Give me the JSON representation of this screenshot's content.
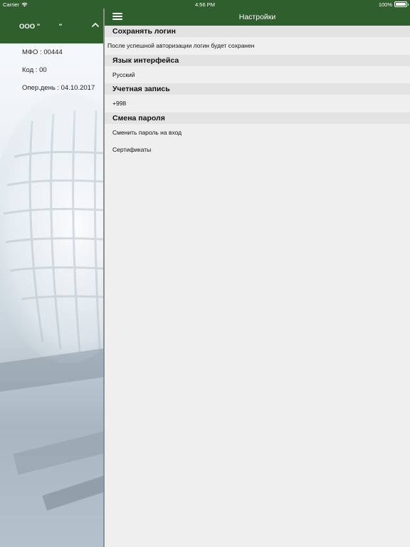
{
  "status_bar": {
    "carrier": "Carrier",
    "time": "4:56 PM",
    "battery": "100%"
  },
  "sidebar": {
    "org_name": "ООО \"          \"",
    "mfo": "МФО : 00444",
    "kod": "Код : 00",
    "oper_day": "Опер.день : 04.10.2017"
  },
  "nav": {
    "title": "Настройки"
  },
  "settings": {
    "save_login": {
      "header": "Сохранять логин",
      "description": "После успешной авторизации логин будет сохранен"
    },
    "language": {
      "header": "Язык интерфейса",
      "value": "Русский"
    },
    "account": {
      "header": "Учетная запись",
      "value": "+998"
    },
    "password": {
      "header": "Смена пароля",
      "change_on_login": "Сменить пароль на вход",
      "certificates": "Сертификаты"
    }
  },
  "colors": {
    "brand_green": "#2f5f2d",
    "section_bg": "#e3e3e3",
    "page_bg": "#efefef"
  }
}
